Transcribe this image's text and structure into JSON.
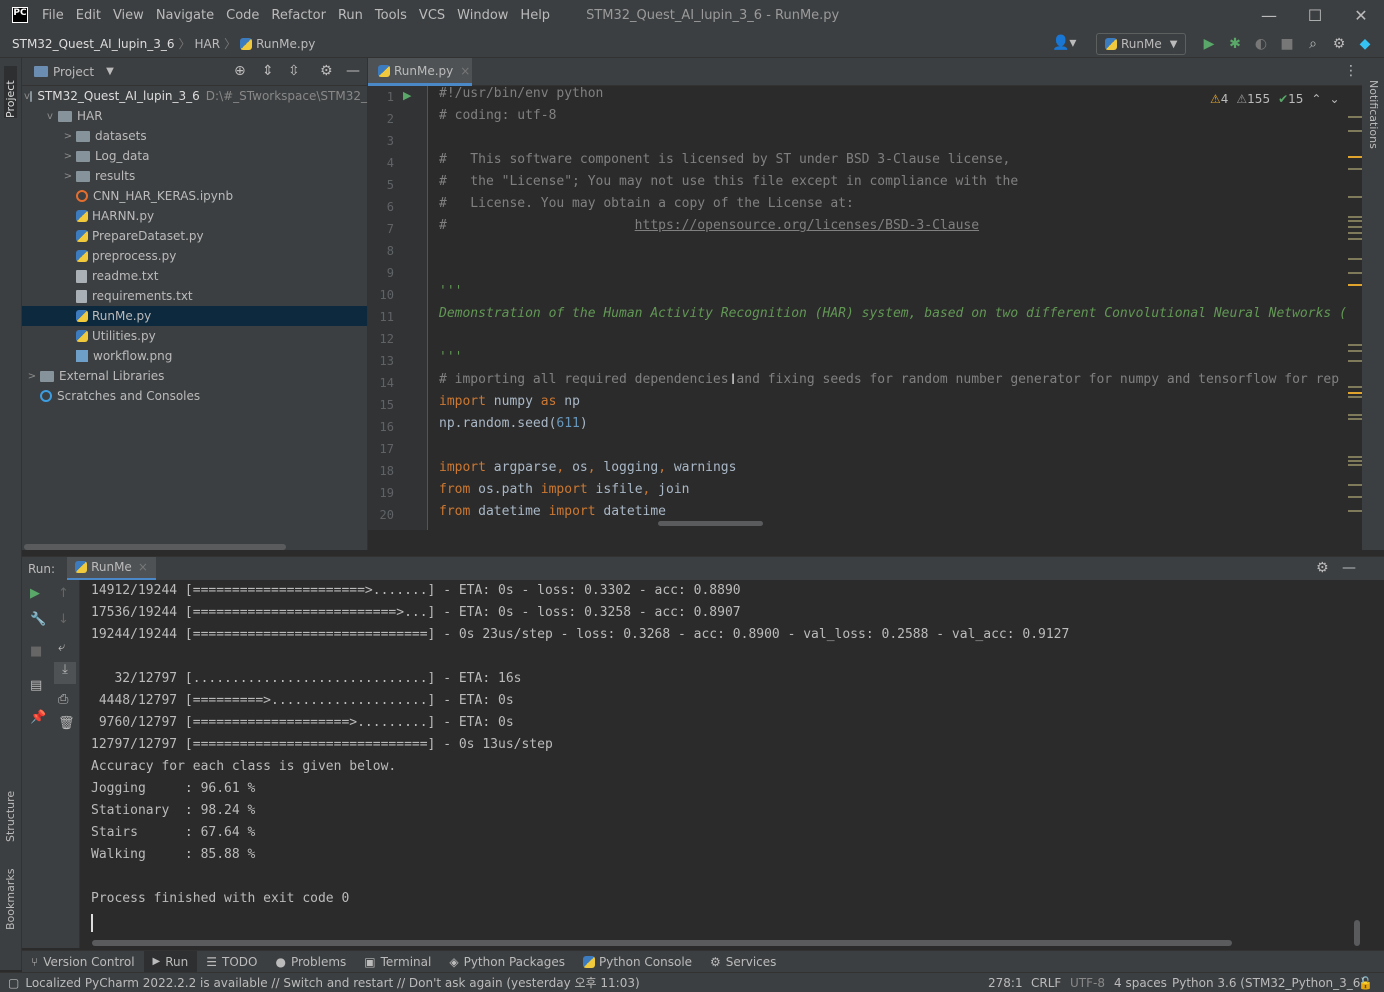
{
  "app": {
    "title": "STM32_Quest_AI_lupin_3_6 - RunMe.py",
    "logo": "PC"
  },
  "menu": [
    "File",
    "Edit",
    "View",
    "Navigate",
    "Code",
    "Refactor",
    "Run",
    "Tools",
    "VCS",
    "Window",
    "Help"
  ],
  "window_controls": {
    "minimize": "—",
    "maximize": "☐",
    "close": "✕"
  },
  "breadcrumb": [
    "STM32_Quest_AI_lupin_3_6",
    "HAR",
    "RunMe.py"
  ],
  "run_config": "RunMe",
  "project": {
    "title": "Project",
    "root": {
      "name": "STM32_Quest_AI_lupin_3_6",
      "path": "D:\\#_STworkspace\\STM32_"
    },
    "items": [
      {
        "label": "HAR",
        "type": "folder",
        "depth": 1,
        "arrow": "v"
      },
      {
        "label": "datasets",
        "type": "folder",
        "depth": 2,
        "arrow": ">"
      },
      {
        "label": "Log_data",
        "type": "folder",
        "depth": 2,
        "arrow": ">"
      },
      {
        "label": "results",
        "type": "folder",
        "depth": 2,
        "arrow": ">"
      },
      {
        "label": "CNN_HAR_KERAS.ipynb",
        "type": "ipynb",
        "depth": 2,
        "arrow": ""
      },
      {
        "label": "HARNN.py",
        "type": "py",
        "depth": 2,
        "arrow": ""
      },
      {
        "label": "PrepareDataset.py",
        "type": "py",
        "depth": 2,
        "arrow": ""
      },
      {
        "label": "preprocess.py",
        "type": "py",
        "depth": 2,
        "arrow": ""
      },
      {
        "label": "readme.txt",
        "type": "txt",
        "depth": 2,
        "arrow": ""
      },
      {
        "label": "requirements.txt",
        "type": "txt",
        "depth": 2,
        "arrow": ""
      },
      {
        "label": "RunMe.py",
        "type": "py",
        "depth": 2,
        "arrow": "",
        "selected": true
      },
      {
        "label": "Utilities.py",
        "type": "py",
        "depth": 2,
        "arrow": ""
      },
      {
        "label": "workflow.png",
        "type": "png",
        "depth": 2,
        "arrow": ""
      },
      {
        "label": "External Libraries",
        "type": "lib",
        "depth": 0,
        "arrow": ">"
      },
      {
        "label": "Scratches and Consoles",
        "type": "scratch",
        "depth": 0,
        "arrow": ""
      }
    ]
  },
  "editor": {
    "tab": "RunMe.py",
    "inspections": {
      "warnings": "4",
      "weak": "155",
      "typos": "15"
    },
    "line_numbers": [
      "1",
      "2",
      "3",
      "4",
      "5",
      "6",
      "7",
      "8",
      "9",
      "10",
      "11",
      "12",
      "13",
      "14",
      "15",
      "16",
      "17",
      "18",
      "19",
      "20"
    ]
  },
  "run": {
    "label": "Run:",
    "tab": "RunMe",
    "console": [
      "14912/19244 [======================>.......] - ETA: 0s - loss: 0.3302 - acc: 0.8890",
      "17536/19244 [==========================>...] - ETA: 0s - loss: 0.3258 - acc: 0.8907",
      "19244/19244 [==============================] - 0s 23us/step - loss: 0.3268 - acc: 0.8900 - val_loss: 0.2588 - val_acc: 0.9127",
      "",
      "   32/12797 [..............................] - ETA: 16s",
      " 4448/12797 [=========>....................] - ETA: 0s",
      " 9760/12797 [====================>.........] - ETA: 0s",
      "12797/12797 [==============================] - 0s 13us/step",
      "Accuracy for each class is given below.",
      "Jogging     : 96.61 %",
      "Stationary  : 98.24 %",
      "Stairs      : 67.64 %",
      "Walking     : 85.88 %",
      "",
      "Process finished with exit code 0"
    ]
  },
  "bottom_tabs": [
    "Version Control",
    "Run",
    "TODO",
    "Problems",
    "Terminal",
    "Python Packages",
    "Python Console",
    "Services"
  ],
  "side_labels": {
    "project": "Project",
    "structure": "Structure",
    "bookmarks": "Bookmarks",
    "notifications": "Notifications"
  },
  "status": {
    "message": "Localized PyCharm 2022.2.2 is available // Switch and restart // Don't ask again (yesterday 오후 11:03)",
    "position": "278:1",
    "line_sep": "CRLF",
    "encoding": "UTF-8",
    "indent": "4 spaces",
    "interpreter": "Python 3.6 (STM32_Python_3_6)"
  }
}
